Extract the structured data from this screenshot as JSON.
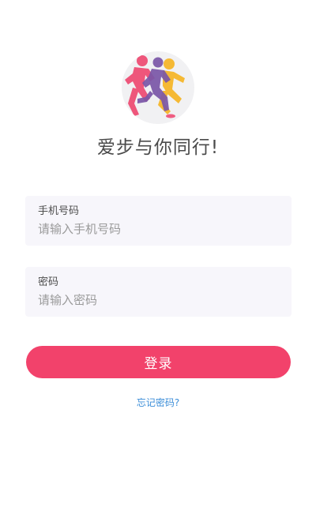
{
  "app": {
    "title": "爱步与你同行!",
    "logo_icon": "runners-logo-icon"
  },
  "form": {
    "phone": {
      "label": "手机号码",
      "placeholder": "请输入手机号码",
      "value": ""
    },
    "password": {
      "label": "密码",
      "placeholder": "请输入密码",
      "value": ""
    },
    "login_label": "登录",
    "forgot_label": "忘记密码?"
  },
  "colors": {
    "accent": "#f2426b",
    "link": "#3c8ed8",
    "field_bg": "#f7f6fb",
    "runner_pink": "#ee4d74",
    "runner_purple": "#7a56a8",
    "runner_yellow": "#f5b62a"
  }
}
